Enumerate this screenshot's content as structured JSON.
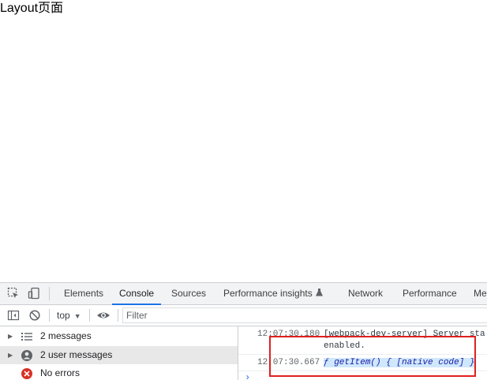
{
  "page": {
    "heading": "Layout页面"
  },
  "devtools": {
    "toolbar_icons": [
      "inspect-element-icon",
      "device-toolbar-icon"
    ],
    "tabs": [
      {
        "label": "Elements",
        "active": false
      },
      {
        "label": "Console",
        "active": true
      },
      {
        "label": "Sources",
        "active": false
      },
      {
        "label": "Performance insights",
        "active": false,
        "icon": "flask-icon"
      },
      {
        "label": "Network",
        "active": false
      },
      {
        "label": "Performance",
        "active": false
      },
      {
        "label": "Me",
        "active": false
      }
    ],
    "filterbar": {
      "context": "top",
      "filter_placeholder": "Filter"
    },
    "sidebar": {
      "items": [
        {
          "label": "2 messages",
          "icon": "list-icon",
          "selected": false
        },
        {
          "label": "2 user messages",
          "icon": "user-icon",
          "selected": true
        },
        {
          "label": "No errors",
          "icon": "error-icon",
          "selected": false
        }
      ]
    },
    "console": {
      "messages": [
        {
          "timestamp": "12:07:30.180",
          "text": "[webpack-dev-server] Server sta",
          "continuation": "enabled."
        },
        {
          "timestamp": "12:07:30.667",
          "fn_prefix": "ƒ",
          "text": " getItem() { [native code] }"
        }
      ],
      "prompt": "›"
    },
    "colors": {
      "accent": "#1a73e8",
      "highlight_box": "#e02020",
      "error": "#d93025"
    }
  }
}
